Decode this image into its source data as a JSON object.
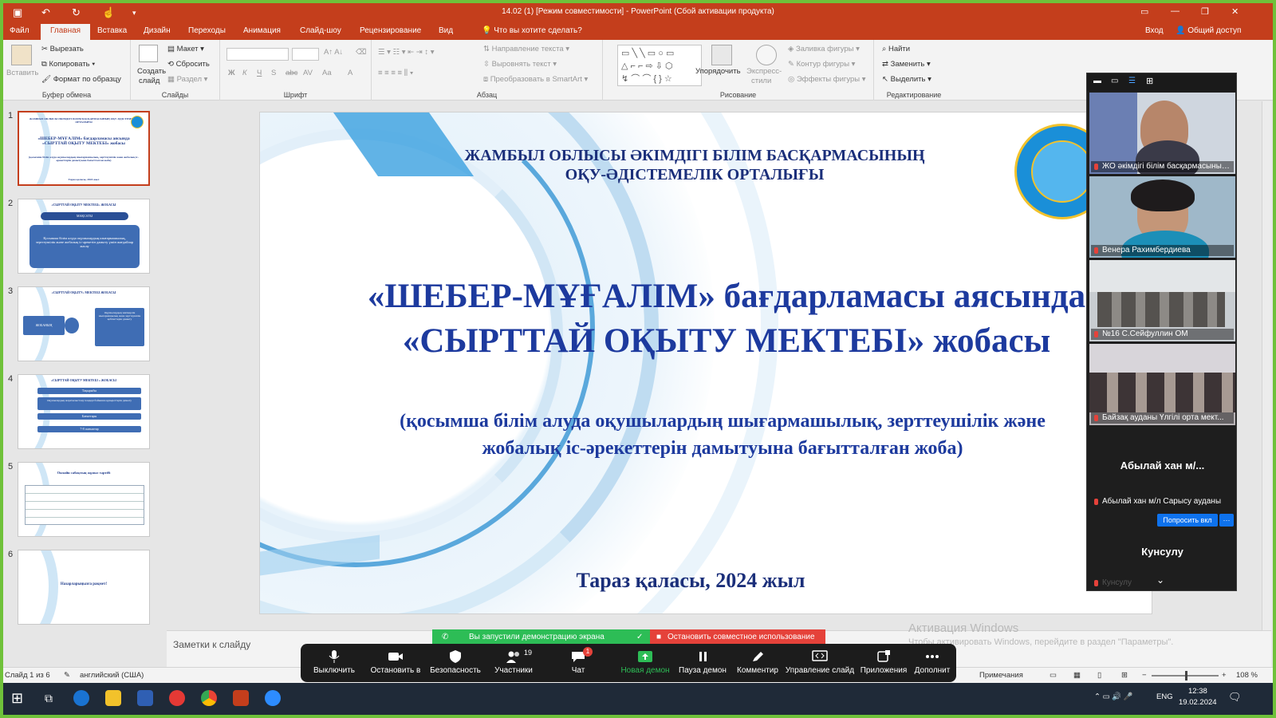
{
  "window": {
    "title": "14.02 (1) [Режим совместимости] - PowerPoint (Сбой активации продукта)"
  },
  "tabs": [
    "Файл",
    "Главная",
    "Вставка",
    "Дизайн",
    "Переходы",
    "Анимация",
    "Слайд-шоу",
    "Рецензирование",
    "Вид"
  ],
  "tell_me": "Что вы хотите сделать?",
  "signin": "Вход",
  "share": "Общий доступ",
  "ribbon": {
    "clipboard": {
      "paste": "Вставить",
      "cut": "Вырезать",
      "copy": "Копировать",
      "format_painter": "Формат по образцу",
      "label": "Буфер обмена"
    },
    "slides": {
      "new_slide_1": "Создать",
      "new_slide_2": "слайд",
      "layout": "Макет",
      "reset": "Сбросить",
      "section": "Раздел",
      "label": "Слайды"
    },
    "font": {
      "label": "Шрифт"
    },
    "paragraph": {
      "text_direction": "Направление текста",
      "align_text": "Выровнять текст",
      "smartart": "Преобразовать в SmartArt",
      "label": "Абзац"
    },
    "drawing": {
      "arrange": "Упорядочить",
      "quick_styles_1": "Экспресс-",
      "quick_styles_2": "стили",
      "shape_fill": "Заливка фигуры",
      "shape_outline": "Контур фигуры",
      "shape_effects": "Эффекты фигуры",
      "label": "Рисование"
    },
    "editing": {
      "find": "Найти",
      "replace": "Заменить",
      "select": "Выделить",
      "label": "Редактирование"
    }
  },
  "thumbnails": [
    {
      "num": "1",
      "line1": "ЖАМБЫЛ ОБЛЫСЫ ӘКІМДІГІ БІЛІМ БАСҚАРМАСЫНЫҢ ОҚУ-ӘДІСТЕМЕЛІК ОРТАЛЫҒЫ",
      "line2": "«ШЕБЕР-МҰҒАЛІМ» бағдарламасы аясында «СЫРТТАЙ ОҚЫТУ МЕКТЕБІ» жобасы",
      "line3": "(қосымша білім алуда оқушылардың шығармашылық, зерттеушілік және жобалық іс-әрекеттерін дамытуына бағытталған жоба)",
      "line4": "Тараз қаласы, 2024 жыл"
    },
    {
      "num": "2",
      "line1": "«СЫРТТАЙ ОҚЫТУ МЕКТЕБІ» ЖОБАСЫ",
      "line2": "МАҚСАТЫ",
      "line3": "Қосымша білім алуда оқушылардың шығармашылық, зерттеушілік және жобалық іс-әрекетін дамыту үшін жағдайлар жасау"
    },
    {
      "num": "3",
      "line1": "«СЫРТТАЙ ОҚЫТУ» МЕКТЕБІ ЖОБАСЫ",
      "line2": "ЖОБАНЫҢ",
      "line3": "Оқушылардың зияткерлік шығармашылық және зерттеушілік қабілеттерін дамыту"
    },
    {
      "num": "4",
      "line1": "«СЫРТТАЙ ОҚЫТУ МЕКТЕБІ » ЖОБАСЫ",
      "line2": "Тақырыбы",
      "line3": "Оқушылардың жаратылыстану пәндері бойынша құзыреттерін дамыту",
      "line4": "Бағыттары",
      "line5": "7-8 сыныптар"
    },
    {
      "num": "5",
      "line1": "Онлайн сабақтың жұмыс тәртібі"
    },
    {
      "num": "6",
      "line1": "Назарларыңызға рақмет!"
    }
  ],
  "slide": {
    "header1": "ЖАМБЫЛ ОБЛЫСЫ ӘКІМДІГІ БІЛІМ БАСҚАРМАСЫНЫҢ",
    "header2": "ОҚУ-ӘДІСТЕМЕЛІК ОРТАЛЫҒЫ",
    "title1": "«ШЕБЕР-МҰҒАЛІМ» бағдарламасы аясында",
    "title2": "«СЫРТТАЙ ОҚЫТУ МЕКТЕБІ» жобасы",
    "subtitle1": "(қосымша білім алуда оқушылардың шығармашылық, зерттеушілік және",
    "subtitle2": "жобалық іс-әрекеттерін дамытуына бағытталған жоба)",
    "footer": "Тараз қаласы, 2024 жыл"
  },
  "notes_placeholder": "Заметки к слайду",
  "activation": {
    "title": "Активация Windows",
    "text": "Чтобы активировать Windows, перейдите в раздел \"Параметры\"."
  },
  "statusbar": {
    "slide_of": "Слайд 1 из 6",
    "language": "английский (США)",
    "comments": "Примечания",
    "zoom": "108 %"
  },
  "zoom": {
    "participants": [
      {
        "name": "ЖО әкімдігі білім басқармасының ..."
      },
      {
        "name": "Венера Рахимбердиева"
      },
      {
        "name": "№16 С.Сейфуллин ОМ"
      },
      {
        "name": "Байзақ ауданы Үлгілі орта мект..."
      },
      {
        "label": "Абылай хан м/...",
        "name": "Абылай хан м/л Сарысу ауданы",
        "ask_button": "Попросить вкл",
        "more": "···"
      },
      {
        "label": "Кунсулу",
        "name": "Кунсулу"
      }
    ],
    "banner_sharing": "Вы запустили демонстрацию экрана",
    "banner_stop": "Остановить совместное использование",
    "toolbar": [
      {
        "label": "Выключить",
        "icon": "mic-icon"
      },
      {
        "label": "Остановить в",
        "icon": "video-icon"
      },
      {
        "label": "Безопасность",
        "icon": "shield-icon"
      },
      {
        "label": "Участники",
        "icon": "participants-icon",
        "count": "19"
      },
      {
        "label": "Чат",
        "icon": "chat-icon",
        "badge": "1"
      },
      {
        "label": "Новая демон",
        "icon": "share-icon"
      },
      {
        "label": "Пауза демон",
        "icon": "pause-icon"
      },
      {
        "label": "Комментир",
        "icon": "annotate-icon"
      },
      {
        "label": "Управление слайд",
        "icon": "slide-control-icon"
      },
      {
        "label": "Приложения",
        "icon": "apps-icon"
      },
      {
        "label": "Дополнит",
        "icon": "more-icon"
      }
    ]
  },
  "taskbar": {
    "lang": "ENG",
    "time": "12:38",
    "date": "19.02.2024"
  },
  "colors": {
    "accent": "#c43e1c",
    "slide_text": "#1d3a9e",
    "zoom_green": "#2dbd56",
    "zoom_red": "#e5423a",
    "monitor_border": "#6fc13a"
  }
}
